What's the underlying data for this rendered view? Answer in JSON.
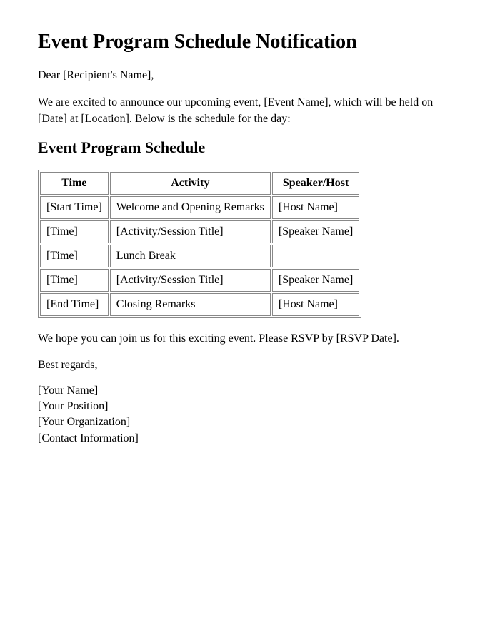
{
  "title": "Event Program Schedule Notification",
  "greeting": "Dear [Recipient's Name],",
  "intro": "We are excited to announce our upcoming event, [Event Name], which will be held on [Date] at [Location]. Below is the schedule for the day:",
  "schedule_heading": "Event Program Schedule",
  "table": {
    "headers": {
      "time": "Time",
      "activity": "Activity",
      "speaker": "Speaker/Host"
    },
    "rows": [
      {
        "time": "[Start Time]",
        "activity": "Welcome and Opening Remarks",
        "speaker": "[Host Name]"
      },
      {
        "time": "[Time]",
        "activity": "[Activity/Session Title]",
        "speaker": "[Speaker Name]"
      },
      {
        "time": "[Time]",
        "activity": "Lunch Break",
        "speaker": ""
      },
      {
        "time": "[Time]",
        "activity": "[Activity/Session Title]",
        "speaker": "[Speaker Name]"
      },
      {
        "time": "[End Time]",
        "activity": "Closing Remarks",
        "speaker": "[Host Name]"
      }
    ]
  },
  "closing": "We hope you can join us for this exciting event. Please RSVP by [RSVP Date].",
  "signoff": "Best regards,",
  "signature": {
    "name": "[Your Name]",
    "position": "[Your Position]",
    "organization": "[Your Organization]",
    "contact": "[Contact Information]"
  }
}
